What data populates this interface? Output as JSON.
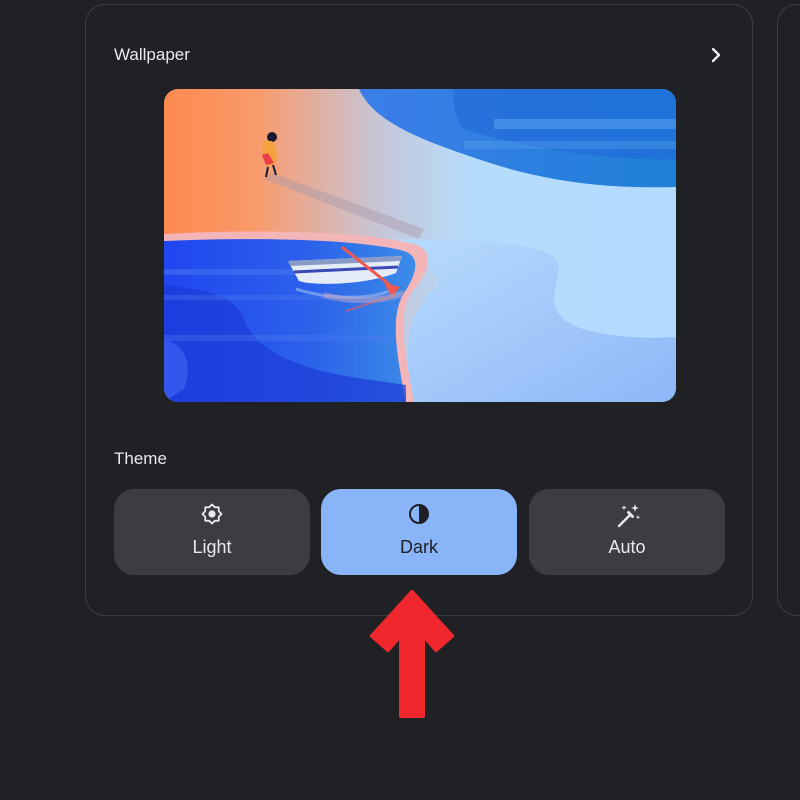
{
  "wallpaper": {
    "title": "Wallpaper",
    "open_icon": "chevron-right-icon",
    "preview_description_icon": "wallpaper-preview"
  },
  "theme": {
    "title": "Theme",
    "selected": "Dark",
    "options": [
      {
        "label": "Light",
        "icon": "brightness-icon"
      },
      {
        "label": "Dark",
        "icon": "contrast-icon"
      },
      {
        "label": "Auto",
        "icon": "magic-wand-icon"
      }
    ]
  },
  "colors": {
    "background": "#202124",
    "card_border": "#3c3d40",
    "button_bg": "#3c3d40",
    "selected_button_bg": "#8ab4f8",
    "text": "#e8eaed",
    "annotation_arrow": "#f0282d"
  }
}
